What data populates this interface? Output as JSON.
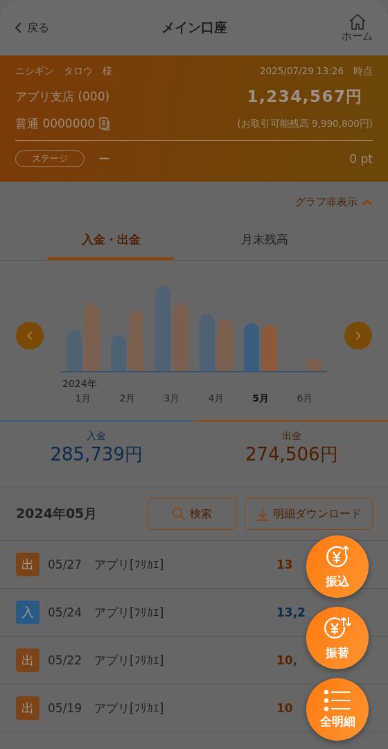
{
  "header": {
    "back": "戻る",
    "title": "メイン口座",
    "home": "ホーム"
  },
  "account": {
    "holder": "ニシギン　タロウ　様",
    "as_of": "2025/07/29 13:26　時点",
    "branch": "アプリ支店 (000)",
    "balance": "1,234,567円",
    "number": "普通 0000000",
    "available": "(お取引可能残高 9,990,800円)",
    "stage_label": "ステージ",
    "stage_value": "ー",
    "points": "0 pt"
  },
  "graph_toggle": "グラフ非表示",
  "tabs": [
    {
      "label": "入金・出金",
      "selected": true
    },
    {
      "label": "月末残高",
      "selected": false
    }
  ],
  "chart": {
    "year": "2024年",
    "months": [
      {
        "label": "1月",
        "selected": false
      },
      {
        "label": "2月",
        "selected": false
      },
      {
        "label": "3月",
        "selected": false
      },
      {
        "label": "4月",
        "selected": false
      },
      {
        "label": "5月",
        "selected": true
      },
      {
        "label": "6月",
        "selected": false
      }
    ]
  },
  "totals": [
    {
      "kind": "deposit",
      "label": "入金",
      "amount": "285,739円"
    },
    {
      "kind": "withdrawal",
      "label": "出金",
      "amount": "274,506円"
    }
  ],
  "period": "2024年05月",
  "search_button": "検索",
  "download_button": "明細ダウンロード",
  "transactions": [
    {
      "kind": "withdrawal",
      "badge": "出",
      "date": "05/27",
      "description": "アプリ[ﾌﾘｶｴ]",
      "amount": "13"
    },
    {
      "kind": "deposit",
      "badge": "入",
      "date": "05/24",
      "description": "アプリ[ﾌﾘｶｴ]",
      "amount": "13,2"
    },
    {
      "kind": "withdrawal",
      "badge": "出",
      "date": "05/22",
      "description": "アプリ[ﾌﾘｶｴ]",
      "amount": "10,"
    },
    {
      "kind": "withdrawal",
      "badge": "出",
      "date": "05/19",
      "description": "アプリ[ﾌﾘｶｴ]",
      "amount": "10"
    }
  ],
  "actions": [
    {
      "kind": "transfer",
      "label": "振込"
    },
    {
      "kind": "exchange",
      "label": "振替"
    },
    {
      "kind": "list",
      "label": "全明細"
    }
  ]
}
